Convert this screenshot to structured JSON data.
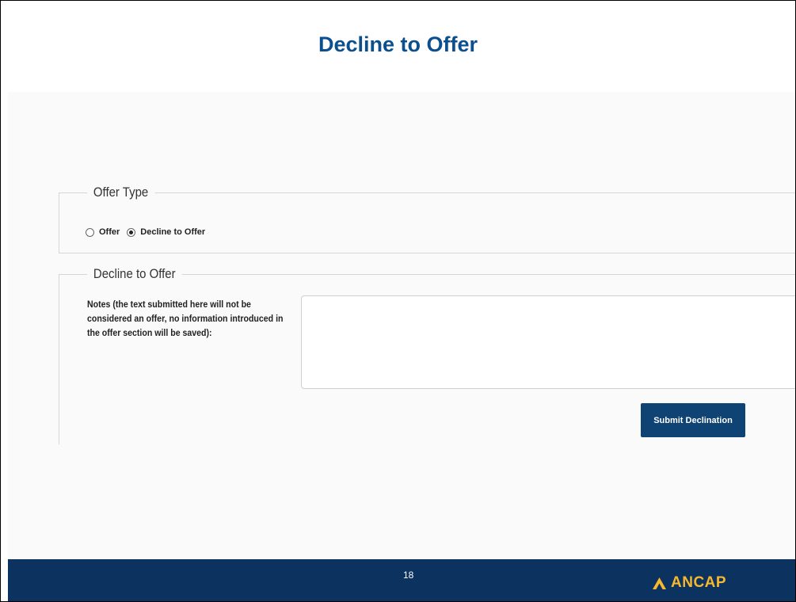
{
  "slide": {
    "title": "Decline to Offer",
    "page_number": "18"
  },
  "offer_type": {
    "legend": "Offer Type",
    "options": [
      {
        "label": "Offer",
        "selected": false
      },
      {
        "label": "Decline to Offer",
        "selected": true
      }
    ]
  },
  "decline_section": {
    "legend": "Decline to Offer",
    "notes_label": "Notes (the text submitted here will not be considered an offer, no information introduced in the offer section will be saved):",
    "notes_value": "",
    "submit_label": "Submit Declination"
  },
  "footer": {
    "logo_text": "ANCAP",
    "logo_icon": "ancap-triangle-icon",
    "background_color": "#0c3260",
    "logo_color": "#f5b82e"
  },
  "colors": {
    "title": "#0c4f8f",
    "button": "#0e4374"
  }
}
